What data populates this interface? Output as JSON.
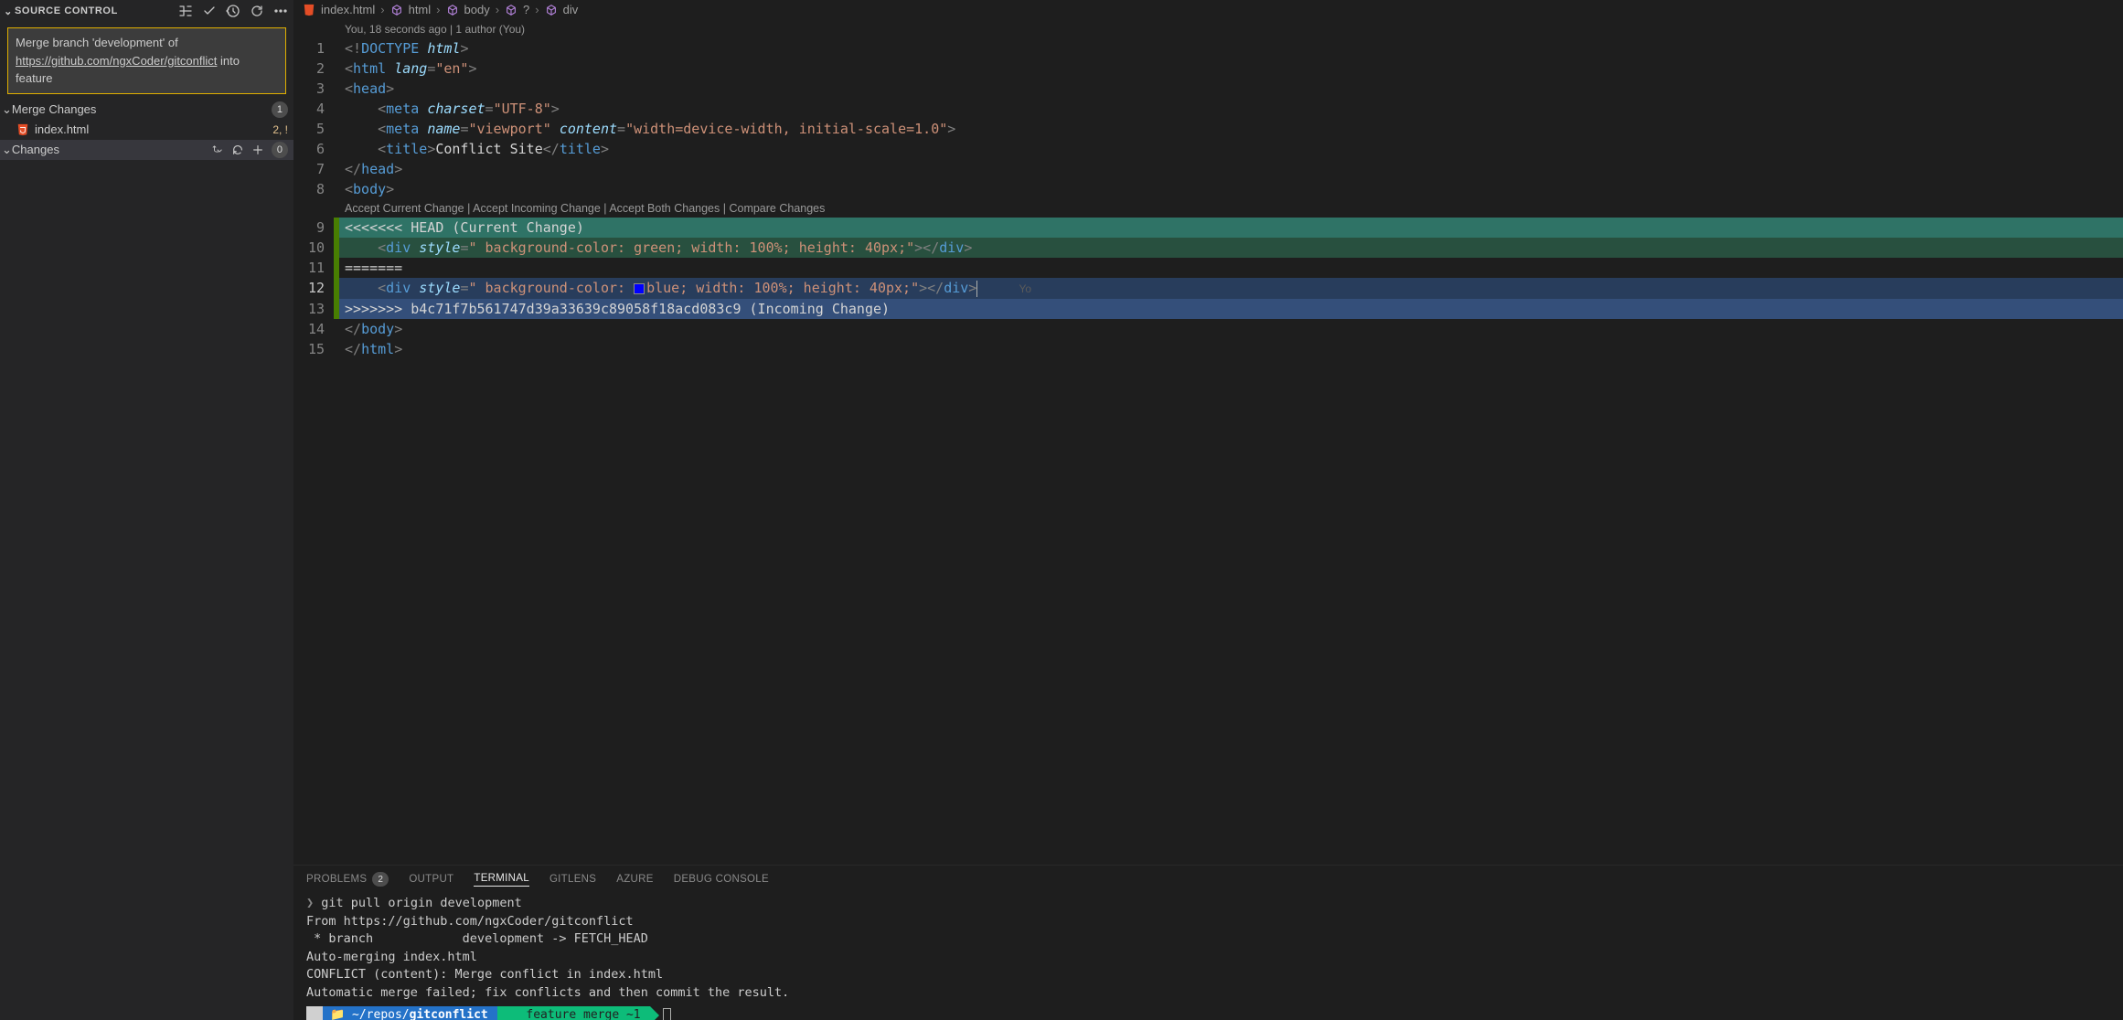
{
  "sidebar": {
    "title": "SOURCE CONTROL",
    "commit_message": {
      "prefix": "Merge branch 'development' of ",
      "url": "https://github.com/ngxCoder/gitconflict",
      "suffix": " into feature"
    },
    "sections": [
      {
        "label": "Merge Changes",
        "badge": "1"
      },
      {
        "label": "Changes",
        "badge": "0"
      }
    ],
    "file": {
      "name": "index.html",
      "status": "2, !"
    }
  },
  "breadcrumb": {
    "file": "index.html",
    "parts": [
      "html",
      "body",
      "?",
      "div"
    ]
  },
  "editor": {
    "blame": "You, 18 seconds ago | 1 author (You)",
    "codelens": [
      "Accept Current Change",
      "Accept Incoming Change",
      "Accept Both Changes",
      "Compare Changes"
    ],
    "lines": {
      "l1": "<!DOCTYPE html>",
      "l5": "Conflict Site",
      "sep": "=======",
      "head_marker": "<<<<<<< HEAD (Current Change)",
      "foot_marker": ">>>>>>> b4c71f7b561747d39a33639c89058f18acd083c9 (Incoming Change)",
      "style_cur": " background-color: green; width: 100%; height: 40px;",
      "style_inc": " background-color: blue; width: 100%; height: 40px;",
      "inline_blame": "Yo"
    }
  },
  "panel": {
    "tabs": {
      "problems": "PROBLEMS",
      "problems_badge": "2",
      "output": "OUTPUT",
      "terminal": "TERMINAL",
      "gitlens": "GITLENS",
      "azure": "AZURE",
      "debug": "DEBUG CONSOLE"
    },
    "terminal": {
      "cmd": "git pull origin development",
      "out1": "From https://github.com/ngxCoder/gitconflict",
      "out2": " * branch            development -> FETCH_HEAD",
      "out3": "Auto-merging index.html",
      "out4": "CONFLICT (content): Merge conflict in index.html",
      "out5": "Automatic merge failed; fix conflicts and then commit the result.",
      "prompt_path_prefix": "~/repos/",
      "prompt_path_bold": "gitconflict",
      "prompt_branch": "feature",
      "prompt_status": "merge ~1"
    }
  }
}
